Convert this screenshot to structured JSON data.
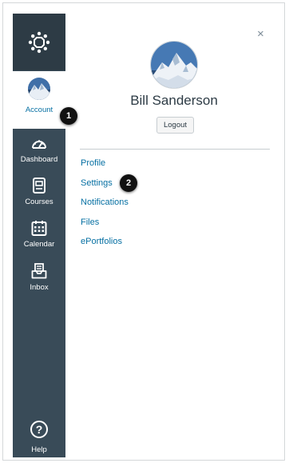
{
  "nav": {
    "items": [
      {
        "label": "Account",
        "icon": "avatar",
        "active": true
      },
      {
        "label": "Dashboard",
        "icon": "dashboard-icon"
      },
      {
        "label": "Courses",
        "icon": "courses-icon"
      },
      {
        "label": "Calendar",
        "icon": "calendar-icon"
      },
      {
        "label": "Inbox",
        "icon": "inbox-icon"
      }
    ],
    "help": {
      "label": "Help",
      "icon": "help-icon",
      "glyph": "?"
    }
  },
  "tray": {
    "close_glyph": "×",
    "user_name": "Bill Sanderson",
    "logout_label": "Logout",
    "links": [
      "Profile",
      "Settings",
      "Notifications",
      "Files",
      "ePortfolios"
    ]
  },
  "callouts": [
    "1",
    "2"
  ],
  "colors": {
    "rail": "#394b58",
    "rail_logo": "#2d3b45",
    "link": "#0770a3",
    "text": "#2d3b45"
  }
}
